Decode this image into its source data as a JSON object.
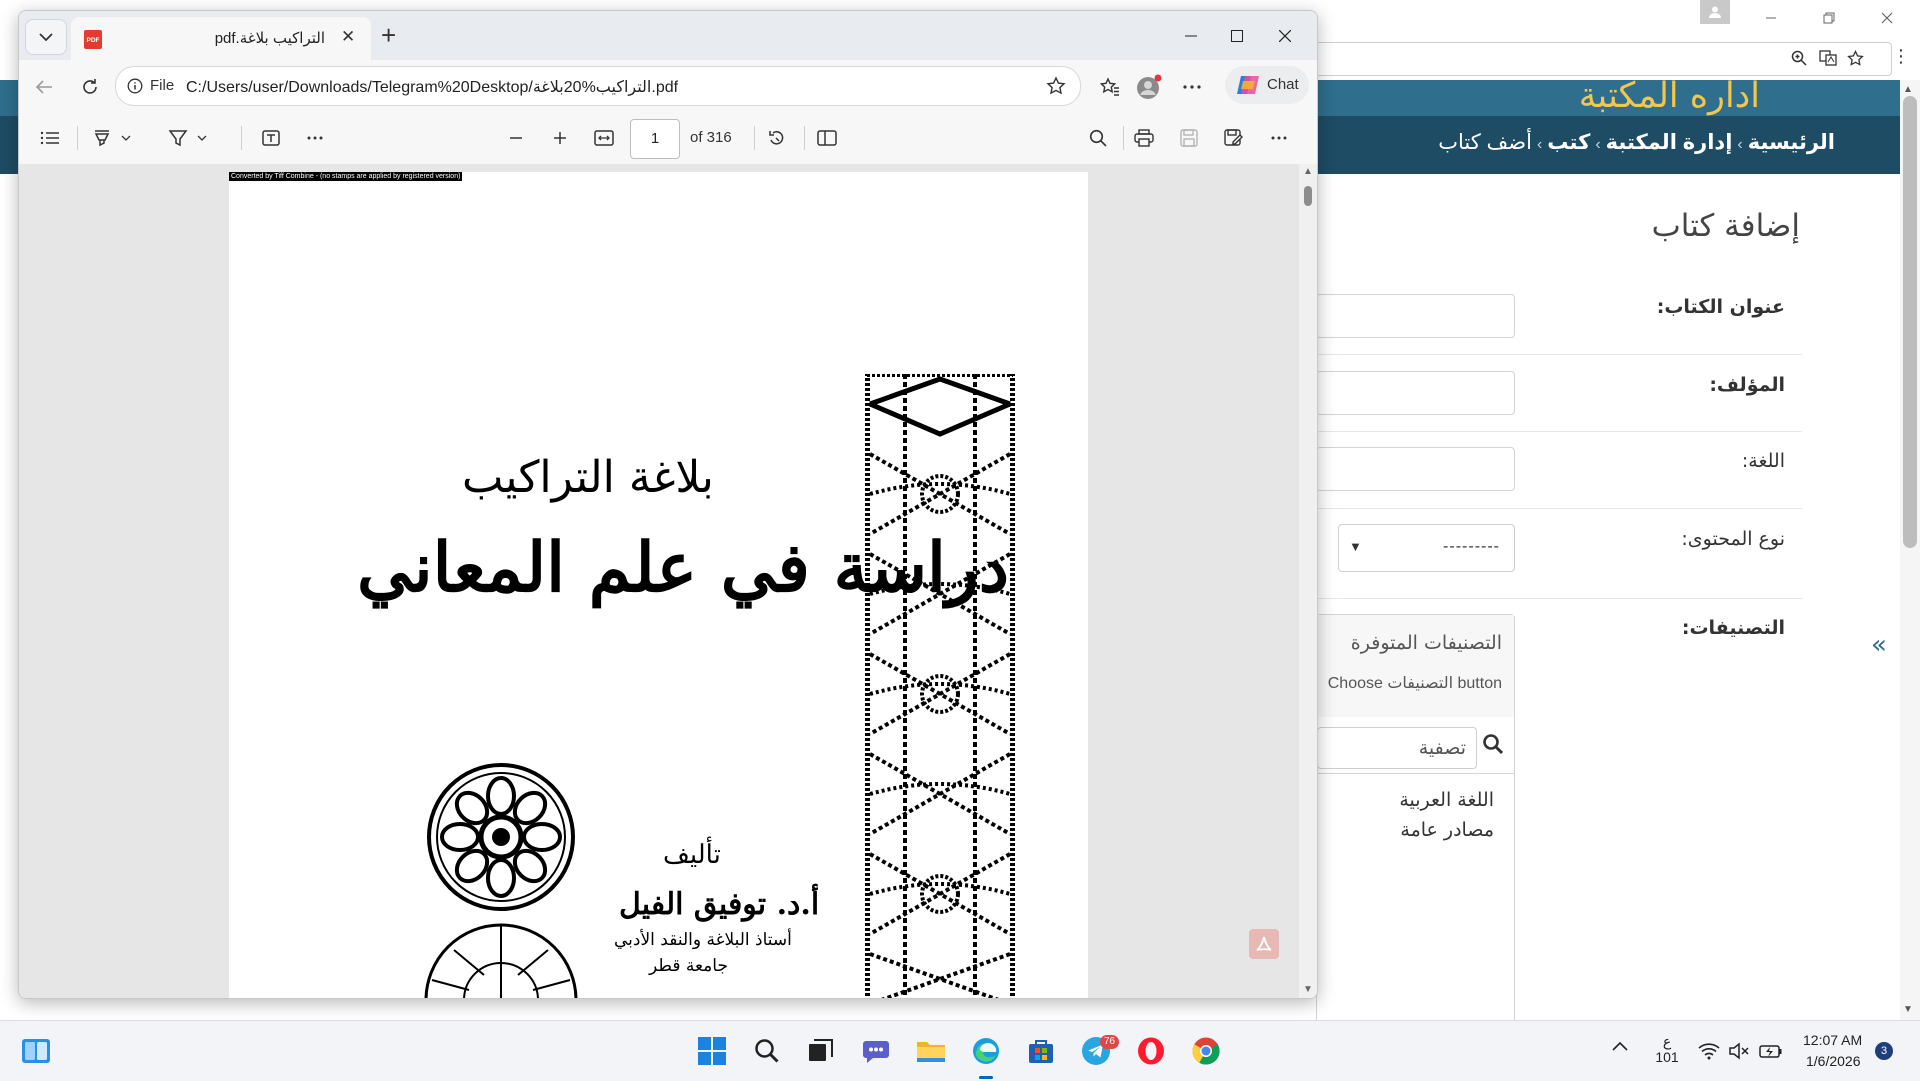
{
  "background_browser": {
    "window_controls": [
      "minimize",
      "restore",
      "close"
    ],
    "address_icons": [
      "zoom-icon",
      "translate-icon",
      "star-icon"
    ]
  },
  "library": {
    "brand": "اداره المكتبة",
    "breadcrumb": {
      "home": "الرئيسية",
      "admin": "إدارة المكتبة",
      "books": "كتب",
      "current": "أضف كتاب"
    },
    "page_heading": "إضافة كتاب",
    "fields": {
      "title_label": "عنوان الكتاب:",
      "author_label": "المؤلف:",
      "language_label": "اللغة:",
      "content_type_label": "نوع المحتوى:",
      "content_type_value": "---------",
      "categories_label": "التصنيفات:"
    },
    "categories_panel": {
      "title": "التصنيفات المتوفرة",
      "help": "Choose التصنيفات button",
      "filter_placeholder": "تصفية",
      "items": [
        "اللغة العربية",
        "مصادر عامة"
      ]
    },
    "collapse_glyph": "«"
  },
  "pdf_window": {
    "tab_title": "التراكيب بلاغة.pdf",
    "url_scheme": "File",
    "url": "C:/Users/user/Downloads/Telegram%20Desktop/التراكيب%20بلاغة.pdf",
    "chat_label": "Chat",
    "toolbar": {
      "page_current": "1",
      "page_of": "of 316"
    },
    "document": {
      "stamp": "Converted by Tiff Combine - (no stamps are applied by registered version)",
      "title_line1": "بلاغة التراكيب",
      "title_line2": "دراسة في علم المعاني",
      "by_label": "تأليف",
      "author": "أ.د. توفيق الفيل",
      "author_role": "أستاذ البلاغة والنقد الأدبي",
      "author_university": "جامعة قطر"
    }
  },
  "taskbar": {
    "telegram_badge": "76",
    "language_line1": "ع",
    "language_line2": "101",
    "time": "12:07 AM",
    "date": "1/6/2026",
    "notification_count": "3"
  }
}
